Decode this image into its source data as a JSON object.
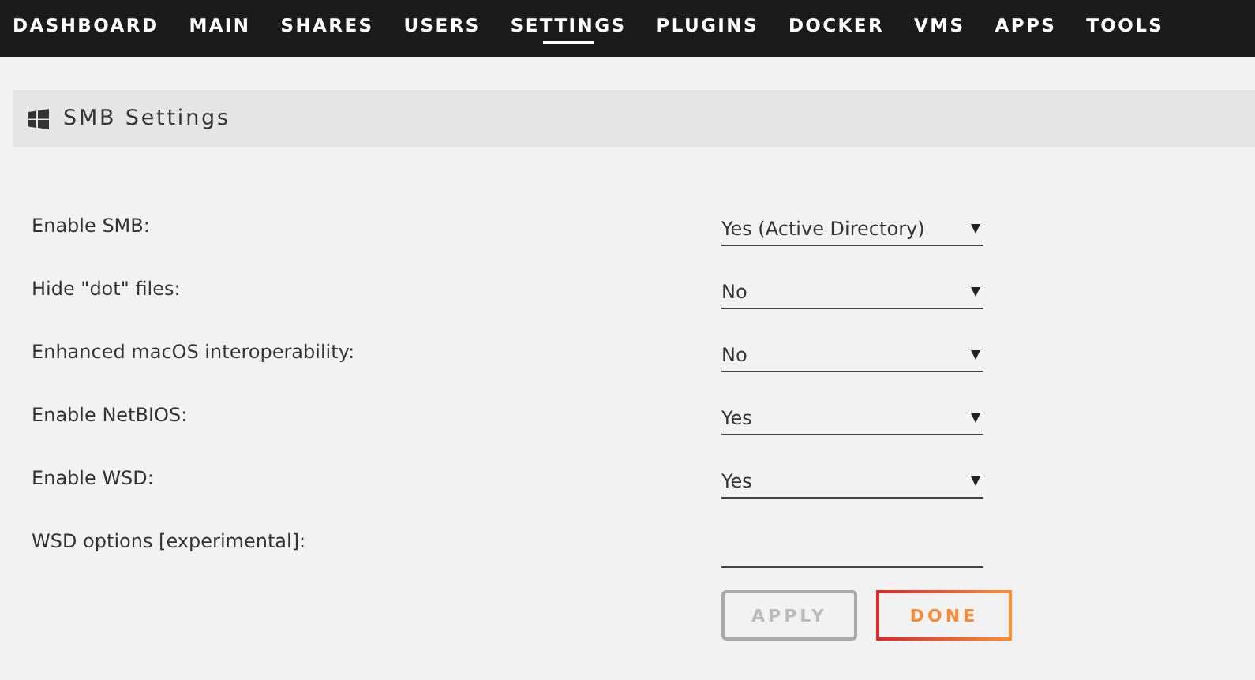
{
  "nav": [
    {
      "label": "DASHBOARD",
      "selected": false
    },
    {
      "label": "MAIN",
      "selected": false
    },
    {
      "label": "SHARES",
      "selected": false
    },
    {
      "label": "USERS",
      "selected": false
    },
    {
      "label": "SETTINGS",
      "selected": true
    },
    {
      "label": "PLUGINS",
      "selected": false
    },
    {
      "label": "DOCKER",
      "selected": false
    },
    {
      "label": "VMS",
      "selected": false
    },
    {
      "label": "APPS",
      "selected": false
    },
    {
      "label": "TOOLS",
      "selected": false
    }
  ],
  "section": {
    "title": "SMB Settings"
  },
  "settings": [
    {
      "label": "Enable SMB:",
      "kind": "select",
      "value": "Yes (Active Directory)"
    },
    {
      "label": "Hide \"dot\" files:",
      "kind": "select",
      "value": "No"
    },
    {
      "label": "Enhanced macOS interoperability:",
      "kind": "select",
      "value": "No"
    },
    {
      "label": "Enable NetBIOS:",
      "kind": "select",
      "value": "Yes"
    },
    {
      "label": "Enable WSD:",
      "kind": "select",
      "value": "Yes"
    },
    {
      "label": "WSD options [experimental]:",
      "kind": "text"
    }
  ],
  "buttons": [
    {
      "label": "APPLY",
      "disabled": true
    },
    {
      "label": "DONE",
      "disabled": false
    }
  ]
}
